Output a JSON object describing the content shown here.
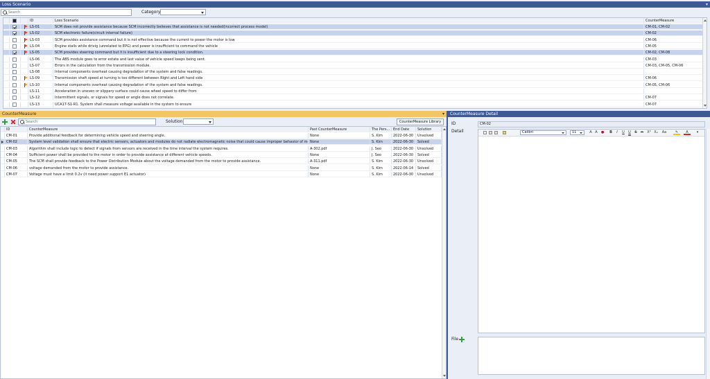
{
  "loss_panel": {
    "title": "Loss Scenario",
    "search_placeholder": "Search",
    "category_label": "Category",
    "columns": {
      "id": "ID",
      "scenario": "Loss Scenario",
      "countermeasure": "CounterMeasure"
    },
    "rows": [
      {
        "checked": true,
        "flag": "red",
        "id": "LS-01",
        "scenario": "SCM does not provide assistance because SCM incorrectly believes that assistance is not needed(incorrect process model)",
        "cm": "CM-01, CM-02",
        "selected": true
      },
      {
        "checked": true,
        "flag": "red",
        "id": "LS-02",
        "scenario": "SCM electronic failure(circuit internal failure)",
        "cm": "CM-02",
        "selected": true
      },
      {
        "checked": false,
        "flag": "red",
        "id": "LS-03",
        "scenario": "SCM provides assistance command but it is not effective because the current to power the motor is low",
        "cm": "CM-06",
        "selected": false
      },
      {
        "checked": false,
        "flag": "red",
        "id": "LS-04",
        "scenario": "Engine stalls while drivig (unrelated to EPG) and power is insufficient to command the vehicle",
        "cm": "CM-05",
        "selected": false
      },
      {
        "checked": true,
        "flag": "red",
        "id": "LS-05",
        "scenario": "SCM provides steering command but it is insufficient due to a steering lock condition.",
        "cm": "CM-02, CM-08",
        "selected": true
      },
      {
        "checked": false,
        "flag": "none",
        "id": "LS-06",
        "scenario": " The ABS module goes to error estate and last value of vehicle speed keeps being sent.",
        "cm": "CM-03",
        "selected": false
      },
      {
        "checked": false,
        "flag": "none",
        "id": "LS-07",
        "scenario": " Errors in the calculation from the transmission module.",
        "cm": "CM-03, CM-05, CM-06",
        "selected": false
      },
      {
        "checked": false,
        "flag": "none",
        "id": "LS-08",
        "scenario": "Internal components overheat causing degradation of the system and false readings.",
        "cm": "",
        "selected": false
      },
      {
        "checked": false,
        "flag": "orange",
        "id": "LS-09",
        "scenario": "Transmission shaft speed at turning is too different between Right and Left hand side",
        "cm": "CM-06",
        "selected": false
      },
      {
        "checked": false,
        "flag": "orange",
        "id": "LS-10",
        "scenario": " Internal components overheat causing degradation of the system and false readings.",
        "cm": "CM-05, CM-06",
        "selected": false
      },
      {
        "checked": false,
        "flag": "none",
        "id": "LS-11",
        "scenario": " Acceleration in uneven or slippery surface could cause wheel speed to differ from",
        "cm": "",
        "selected": false
      },
      {
        "checked": false,
        "flag": "none",
        "id": "LS-12",
        "scenario": " Intermittent signals, or signals for speed or angle does not correlate.",
        "cm": "CM-07",
        "selected": false
      },
      {
        "checked": false,
        "flag": "none",
        "id": "LS-13",
        "scenario": "UCA17-S1-R1. System shall measure voltage available in the system to ensure",
        "cm": "CM-07",
        "selected": false
      }
    ]
  },
  "cm_panel": {
    "title": "CounterMeasure",
    "search_placeholder": "Search",
    "solution_label": "Solution :",
    "library_button": "CounterMeasure Library",
    "columns": {
      "id": "ID",
      "cm": "CounterMeasure",
      "past": "Past CounterMeasure",
      "person": "The Pers...",
      "end": "End Date",
      "solution": "Solution"
    },
    "rows": [
      {
        "id": "CM-01",
        "cm": "Provide additional feedback for determining vehicle speed and steering angle.",
        "past": "None",
        "person": "S. Kim",
        "end": "2022-06-30",
        "solution": "Unsolved",
        "selected": false
      },
      {
        "id": "CM-02",
        "cm": "System level validation shall ensure that electric sensors, actuators and modules do not radiate electromagnetic noise that could cause improper behavior of mo...",
        "past": "None",
        "person": "S. Kim",
        "end": "2022-06-30",
        "solution": "Solved",
        "selected": true
      },
      {
        "id": "CM-03",
        "cm": "Algorithm shall include logic to detect if signals from sensors are received in the time interval the system requires.",
        "past": "A-302.pdf",
        "person": "J. Seo",
        "end": "2022-06-30",
        "solution": "Unsolved",
        "selected": false
      },
      {
        "id": "CM-04",
        "cm": "Sufficient power shall be provided to the motor in order to provide assistance at different vehicle speeds.",
        "past": "None",
        "person": "J. Seo",
        "end": "2022-06-30",
        "solution": "Solved",
        "selected": false
      },
      {
        "id": "CM-05",
        "cm": "The SCM shall provide feedback to the Power Distribution Module about the voltage demanded from the motor to provide assistance.",
        "past": "A-311.pdf",
        "person": "S. Kim",
        "end": "2022-06-30",
        "solution": "Unsolved",
        "selected": false
      },
      {
        "id": "CM-06",
        "cm": "voltage demanded from the motor to provide assistance.",
        "past": "None",
        "person": "S. Kim",
        "end": "2022-06-14",
        "solution": "Solved",
        "selected": false
      },
      {
        "id": "CM-07",
        "cm": "Voltage must have a limit 0.2v (it need power support E1 actuator)",
        "past": "None",
        "person": "S. Kim",
        "end": "2022-06-30",
        "solution": "Unsolved",
        "selected": false
      }
    ]
  },
  "detail_panel": {
    "title": "CounterMeasure Detail",
    "id_label": "ID",
    "id_value": "CM-02",
    "detail_label": "Detail",
    "file_label": "File",
    "font_name": "Calibri",
    "font_size": "11"
  },
  "colors": {
    "title_blue": "#3e5a95",
    "title_orange": "#f3c564",
    "selected_row": "#c7d3ec"
  }
}
